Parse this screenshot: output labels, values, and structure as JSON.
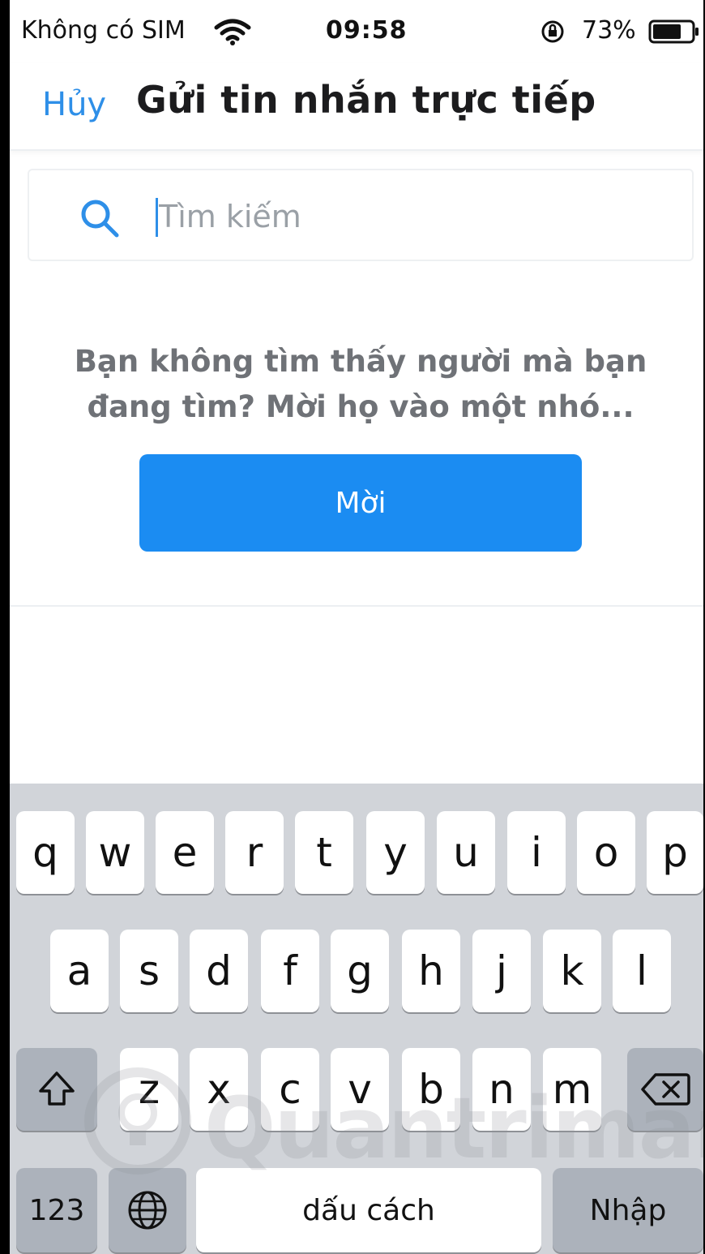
{
  "status_bar": {
    "carrier": "Không có SIM",
    "time": "09:58",
    "battery_percent": "73%",
    "battery_level": 0.73,
    "icons": [
      "wifi-icon",
      "orientation-lock-icon",
      "battery-icon"
    ]
  },
  "nav": {
    "cancel_label": "Hủy",
    "title": "Gửi tin nhắn trực tiếp"
  },
  "search": {
    "placeholder": "Tìm kiếm",
    "value": "",
    "icon": "search-icon"
  },
  "empty_state": {
    "message": "Bạn không tìm thấy người mà bạn đang tìm? Mời họ vào một nhó...",
    "invite_label": "Mời"
  },
  "keyboard": {
    "row1": [
      "q",
      "w",
      "e",
      "r",
      "t",
      "y",
      "u",
      "i",
      "o",
      "p"
    ],
    "row2": [
      "a",
      "s",
      "d",
      "f",
      "g",
      "h",
      "j",
      "k",
      "l"
    ],
    "row3": [
      "z",
      "x",
      "c",
      "v",
      "b",
      "n",
      "m"
    ],
    "numbers_label": "123",
    "space_label": "dấu cách",
    "return_label": "Nhập",
    "icons": [
      "shift-icon",
      "backspace-icon",
      "globe-icon"
    ]
  },
  "watermark": {
    "text": "Quantrimang"
  },
  "colors": {
    "accent": "#1b8cf2",
    "link": "#2e8fe8",
    "keyboard_bg": "#d1d4d9",
    "special_key": "#acb2bb"
  }
}
